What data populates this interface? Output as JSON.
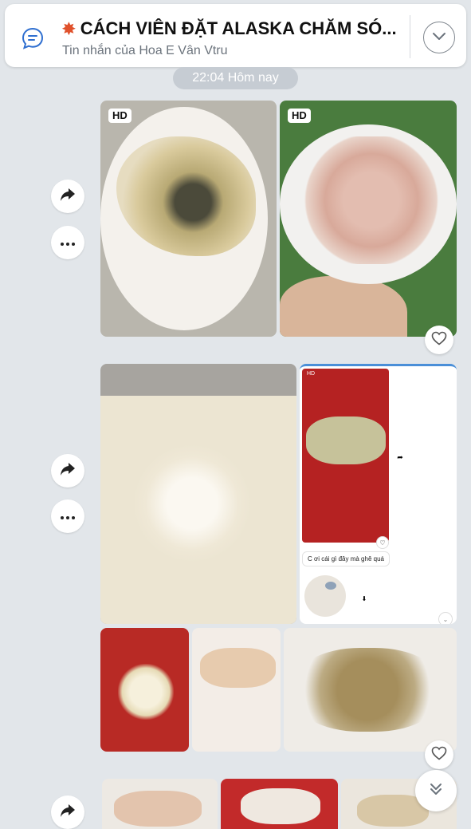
{
  "header": {
    "title_icon": "collision-spark-icon",
    "title": "CÁCH VIÊN ĐẶT ALASKA CHĂM SÓ...",
    "subtitle": "Tin nhắn của Hoa E Vân Vtru"
  },
  "timestamp": "22:04 Hôm nay",
  "photos": {
    "hd_label": "HD"
  },
  "embedded_screenshot": {
    "hd_label": "HD",
    "message_text": "C ơi cái gì đây mà ghê quá"
  },
  "icons": {
    "share": "share-icon",
    "more": "more-icon",
    "heart": "heart-icon",
    "collapse": "chevron-down-icon",
    "scroll_down": "double-chevron-down-icon",
    "chat": "chat-bubble-icon"
  },
  "colors": {
    "background": "#e2e6ea",
    "accent_blue": "#2f6fd0",
    "time_pill": "#c6ccd3"
  }
}
